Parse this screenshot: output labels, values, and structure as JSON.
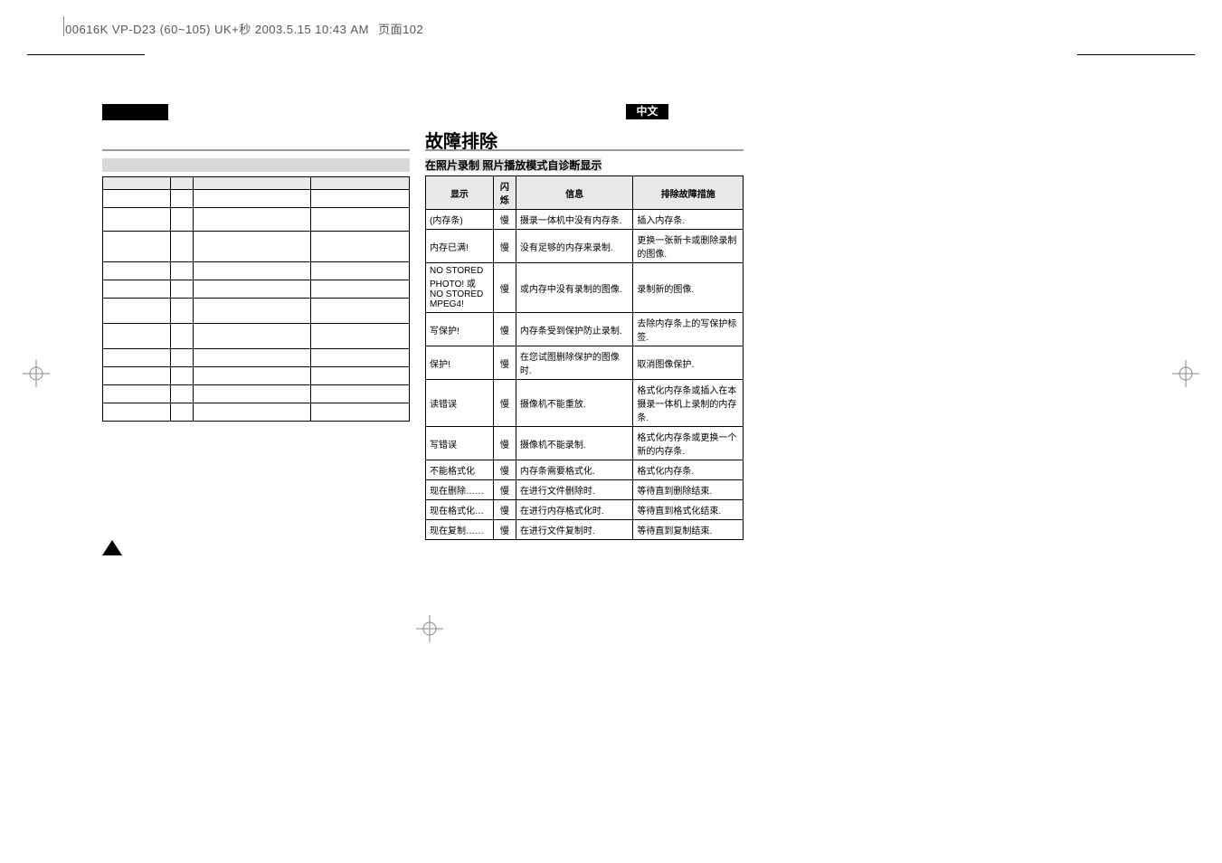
{
  "header": {
    "file_info": "00616K VP-D23 (60~105) UK+秒 2003.5.15 10:43 AM",
    "page_tab": "页面102",
    "lang_label": "中文"
  },
  "title_right": "故障排除",
  "subtitle_right": "在照片录制  照片播放模式自诊断显示",
  "table_headers": {
    "display": "显示",
    "blink": "闪烁",
    "info": "信息",
    "action": "排除故障措施"
  },
  "rows": [
    {
      "display": "(内存条)",
      "blink": "慢",
      "info": "摄录一体机中没有内存条.",
      "action": "插入内存条."
    },
    {
      "display": "内存已满!",
      "blink": "慢",
      "info": "没有足够的内存来录制.",
      "action": "更换一张新卡或删除录制的图像."
    },
    {
      "display": "NO STORED PHOTO! 或 NO STORED MPEG4!",
      "blink": "慢",
      "info": "或内存中没有录制的图像.",
      "action": "录制新的图像."
    },
    {
      "display": "写保护!",
      "blink": "慢",
      "info": "内存条受到保护防止录制.",
      "action": "去除内存条上的写保护标签."
    },
    {
      "display": "保护!",
      "blink": "慢",
      "info": "在您试图删除保护的图像时.",
      "action": "取消图像保护."
    },
    {
      "display": "读错误",
      "blink": "慢",
      "info": "摄像机不能重放.",
      "action": "格式化内存条或插入在本摄录一体机上录制的内存条."
    },
    {
      "display": "写错误",
      "blink": "慢",
      "info": "摄像机不能录制.",
      "action": "格式化内存条或更换一个新的内存条."
    },
    {
      "display": "不能格式化",
      "blink": "慢",
      "info": "内存条需要格式化.",
      "action": "格式化内存条."
    },
    {
      "display": "现在删除……",
      "blink": "慢",
      "info": "在进行文件删除时.",
      "action": "等待直到删除结束."
    },
    {
      "display": "现在格式化…",
      "blink": "慢",
      "info": "在进行内存格式化时.",
      "action": "等待直到格式化结束."
    },
    {
      "display": "现在复制……",
      "blink": "慢",
      "info": "在进行文件复制时.",
      "action": "等待直到复制结束."
    }
  ],
  "left_rows_count": 11
}
